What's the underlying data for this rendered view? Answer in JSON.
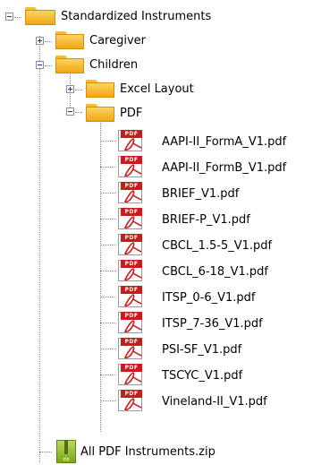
{
  "tree": {
    "root": {
      "label": "Standardized Instruments",
      "icon": "folder-icon",
      "expanded": true
    },
    "caregiver": {
      "label": "Caregiver",
      "icon": "folder-icon",
      "expanded": false
    },
    "children": {
      "label": "Children",
      "icon": "folder-icon",
      "expanded": true
    },
    "excel_layout": {
      "label": "Excel Layout",
      "icon": "folder-icon",
      "expanded": false
    },
    "pdf": {
      "label": "PDF",
      "icon": "folder-icon",
      "expanded": true
    },
    "files": [
      {
        "label": "AAPI-II_FormA_V1.pdf",
        "icon": "pdf-file-icon"
      },
      {
        "label": "AAPI-II_FormB_V1.pdf",
        "icon": "pdf-file-icon"
      },
      {
        "label": "BRIEF_V1.pdf",
        "icon": "pdf-file-icon"
      },
      {
        "label": "BRIEF-P_V1.pdf",
        "icon": "pdf-file-icon"
      },
      {
        "label": "CBCL_1.5-5_V1.pdf",
        "icon": "pdf-file-icon"
      },
      {
        "label": "CBCL_6-18_V1.pdf",
        "icon": "pdf-file-icon"
      },
      {
        "label": "ITSP_0-6_V1.pdf",
        "icon": "pdf-file-icon"
      },
      {
        "label": "ITSP_7-36_V1.pdf",
        "icon": "pdf-file-icon"
      },
      {
        "label": "PSI-SF_V1.pdf",
        "icon": "pdf-file-icon"
      },
      {
        "label": "TSCYC_V1.pdf",
        "icon": "pdf-file-icon"
      },
      {
        "label": "Vineland-II_V1.pdf",
        "icon": "pdf-file-icon"
      }
    ],
    "zip": {
      "label": "All PDF Instruments.zip",
      "icon": "zip-file-icon"
    }
  },
  "colors": {
    "pdf_red": "#cc1a1a",
    "folder_yellow": "#f7bc2a",
    "zip_green": "#8db62a"
  }
}
